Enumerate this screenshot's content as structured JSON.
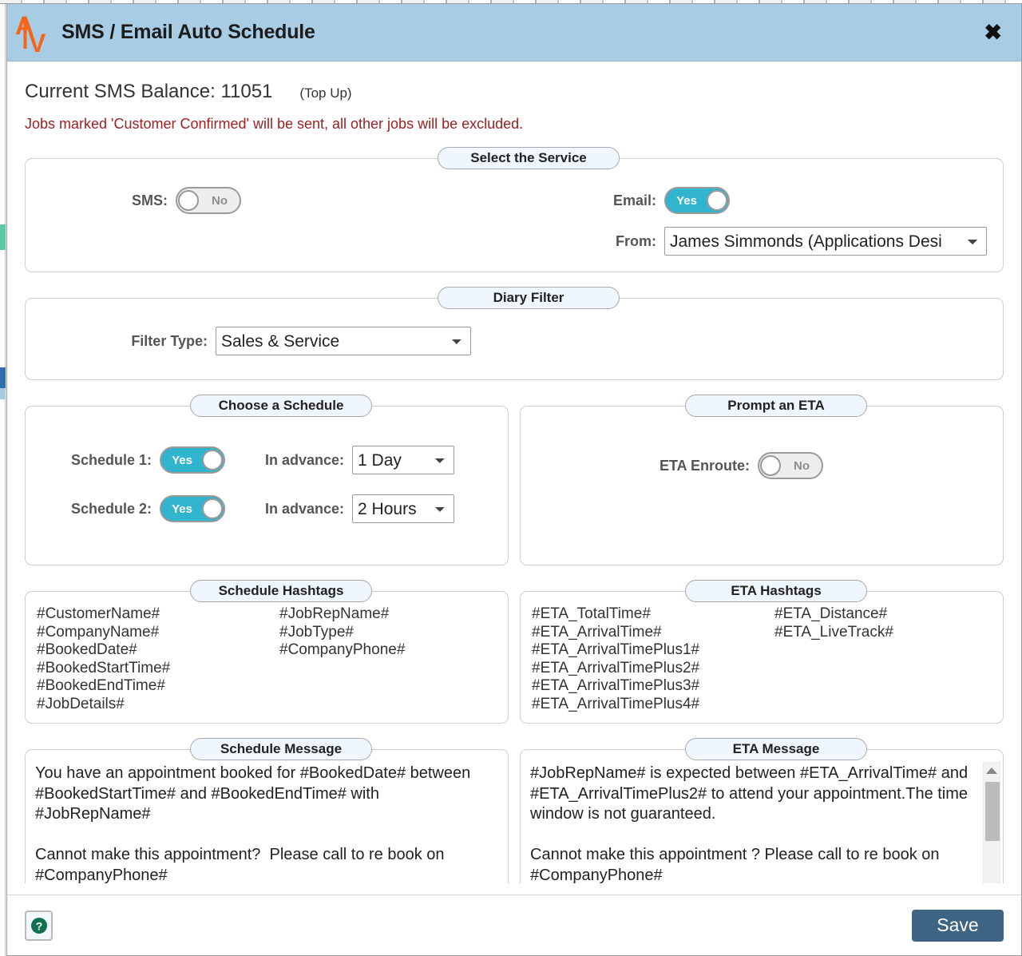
{
  "modal": {
    "title": "SMS / Email Auto Schedule",
    "logo_text": "AV",
    "close_label": "✖"
  },
  "balance": {
    "text": "Current SMS Balance: 11051",
    "topup_label": "(Top Up)"
  },
  "warning": "Jobs marked 'Customer Confirmed' will be sent, all other jobs will be excluded.",
  "service": {
    "legend": "Select the Service",
    "sms_label": "SMS:",
    "sms_value": "No",
    "sms_on": false,
    "email_label": "Email:",
    "email_value": "Yes",
    "email_on": true,
    "from_label": "From:",
    "from_value": "James Simmonds (Applications Desi",
    "from_options": [
      "James Simmonds (Applications Desi"
    ]
  },
  "diary": {
    "legend": "Diary Filter",
    "filter_label": "Filter Type:",
    "filter_value": "Sales & Service",
    "filter_options": [
      "Sales & Service"
    ]
  },
  "schedule": {
    "legend": "Choose a Schedule",
    "rows": [
      {
        "label": "Schedule 1:",
        "toggle_value": "Yes",
        "toggle_on": true,
        "advance_label": "In advance:",
        "advance_value": "1 Day",
        "advance_options": [
          "1 Day"
        ]
      },
      {
        "label": "Schedule 2:",
        "toggle_value": "Yes",
        "toggle_on": true,
        "advance_label": "In advance:",
        "advance_value": "2 Hours",
        "advance_options": [
          "2 Hours"
        ]
      }
    ]
  },
  "eta_prompt": {
    "legend": "Prompt an ETA",
    "enroute_label": "ETA Enroute:",
    "enroute_value": "No",
    "enroute_on": false
  },
  "schedule_hashtags": {
    "legend": "Schedule Hashtags",
    "left": [
      "#CustomerName#",
      "#CompanyName#",
      "#BookedDate#",
      "#BookedStartTime#",
      "#BookedEndTime#",
      "#JobDetails#"
    ],
    "right": [
      "#JobRepName#",
      "#JobType#",
      "#CompanyPhone#"
    ]
  },
  "eta_hashtags": {
    "legend": "ETA Hashtags",
    "left": [
      "#ETA_TotalTime#",
      "#ETA_ArrivalTime#",
      "#ETA_ArrivalTimePlus1#",
      "#ETA_ArrivalTimePlus2#",
      "#ETA_ArrivalTimePlus3#",
      "#ETA_ArrivalTimePlus4#"
    ],
    "right": [
      "#ETA_Distance#",
      "#ETA_LiveTrack#"
    ]
  },
  "schedule_message": {
    "legend": "Schedule Message",
    "value": "You have an appointment booked for #BookedDate# between #BookedStartTime# and #BookedEndTime# with #JobRepName#\n\nCannot make this appointment?  Please call to re book on #CompanyPhone#"
  },
  "eta_message": {
    "legend": "ETA Message",
    "value": "#JobRepName# is expected between #ETA_ArrivalTime# and #ETA_ArrivalTimePlus2# to attend your appointment.The time window is not guaranteed.\n\nCannot make this appointment ? Please call to re book on #CompanyPhone#"
  },
  "footer": {
    "help_label": "?",
    "save_label": "Save"
  },
  "colors": {
    "header_bar": "#a7cce4",
    "toggle_on": "#31b4cd",
    "warning_red": "#9e2020",
    "save_button": "#3d6583",
    "logo_orange": "#f4651a",
    "help_green": "#107050",
    "legend_bg": "#eff6fd"
  }
}
